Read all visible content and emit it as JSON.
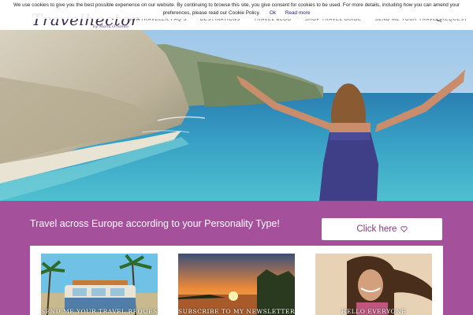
{
  "header": {
    "logo_text": "Travelhector",
    "logo_subtitle": "by Maria Orlando",
    "nav": [
      {
        "label": "HOWTRAVELER FAQ'S"
      },
      {
        "label": "DESTINATIONS"
      },
      {
        "label": "TRAVEL BLOG"
      },
      {
        "label": "SHOP TRAVEL GUIDE"
      },
      {
        "label": "SEND ME YOUR TRAVEL REQUEST"
      }
    ],
    "search_icon": "search-icon"
  },
  "cookie_bar": {
    "text": "We use cookies to give you the best possible experience on our website. By continuing to browse this site, you give consent for cookies to be used. For more details, including how you can amend your preferences, please read our Cookie Policy.",
    "ok_label": "Ok",
    "read_more_label": "Read more"
  },
  "hero": {
    "image": "woman-arms-raised-beach-cliffs"
  },
  "band": {
    "title": "Travel across Europe according to your Personality Type!",
    "cta_label": "Click here",
    "cta_icon": "heart-icon",
    "color": "#a4509a"
  },
  "cards": [
    {
      "label": "SEND ME YOUR TRAVEL REQUEST",
      "image": "van-palm-trees"
    },
    {
      "label": "SUBSCRIBE TO MY NEWSLETTER",
      "image": "sunset-lake"
    },
    {
      "label": "HELLO EVERYONE",
      "image": "smiling-woman-hair-wind"
    }
  ]
}
